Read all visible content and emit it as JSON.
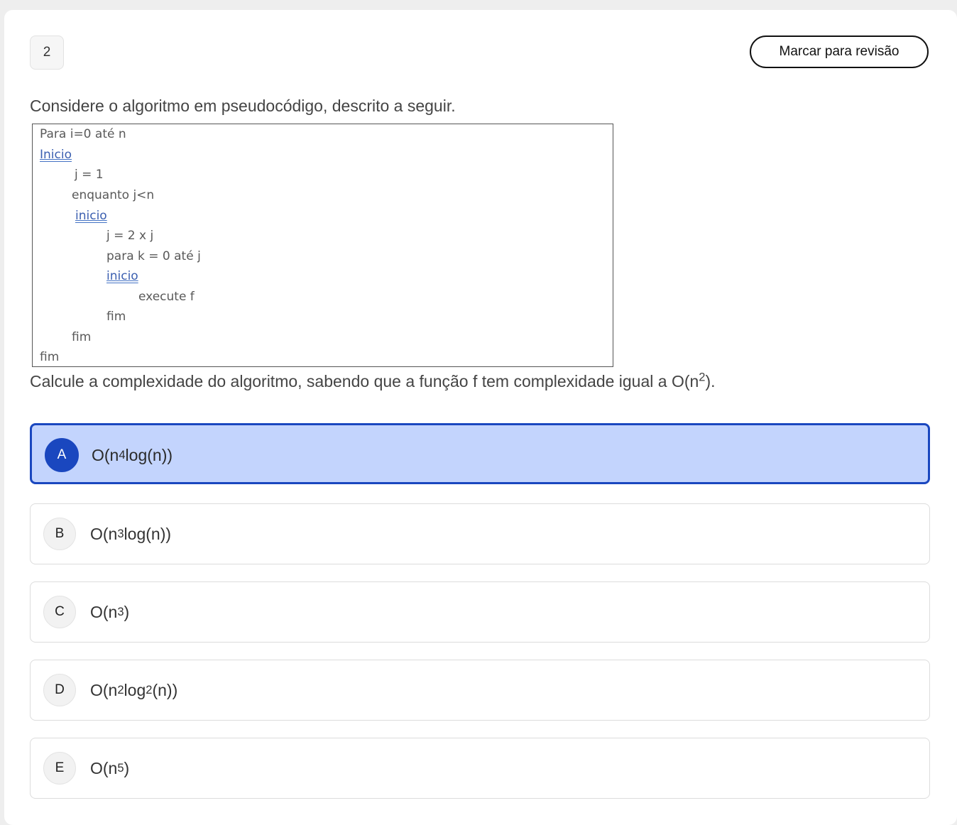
{
  "question": {
    "number": "2",
    "review_button_label": "Marcar para revisão",
    "intro": "Considere o algoritmo em pseudocódigo, descrito a seguir.",
    "code_lines": [
      "Para i=0 até n",
      "Inicio",
      "j = 1",
      "enquanto j<n",
      "inicio",
      "j = 2 x j",
      "para k = 0 até j",
      "inicio",
      "execute f",
      "fim",
      "fim",
      "fim"
    ],
    "prompt_text": "Calcule a complexidade do algoritmo, sabendo que a função f tem complexidade igual a O(n",
    "prompt_exponent": "2",
    "prompt_suffix": ")."
  },
  "options": [
    {
      "letter": "A",
      "pre": "O(n",
      "exp1": "4",
      "mid": "log",
      "exp2": "",
      "post": "(n))",
      "selected": true
    },
    {
      "letter": "B",
      "pre": "O(n",
      "exp1": "3",
      "mid": "log",
      "exp2": "",
      "post": "(n))",
      "selected": false
    },
    {
      "letter": "C",
      "pre": "O(n",
      "exp1": "3",
      "mid": "",
      "exp2": "",
      "post": ")",
      "selected": false
    },
    {
      "letter": "D",
      "pre": "O(n",
      "exp1": "2",
      "mid": "log",
      "exp2": "2",
      "post": "(n))",
      "selected": false
    },
    {
      "letter": "E",
      "pre": "O(n",
      "exp1": "5",
      "mid": "",
      "exp2": "",
      "post": ")",
      "selected": false
    }
  ],
  "colors": {
    "selected_border": "#1a47bf",
    "selected_background": "#c3d4fd",
    "underline": "#4472c4"
  }
}
